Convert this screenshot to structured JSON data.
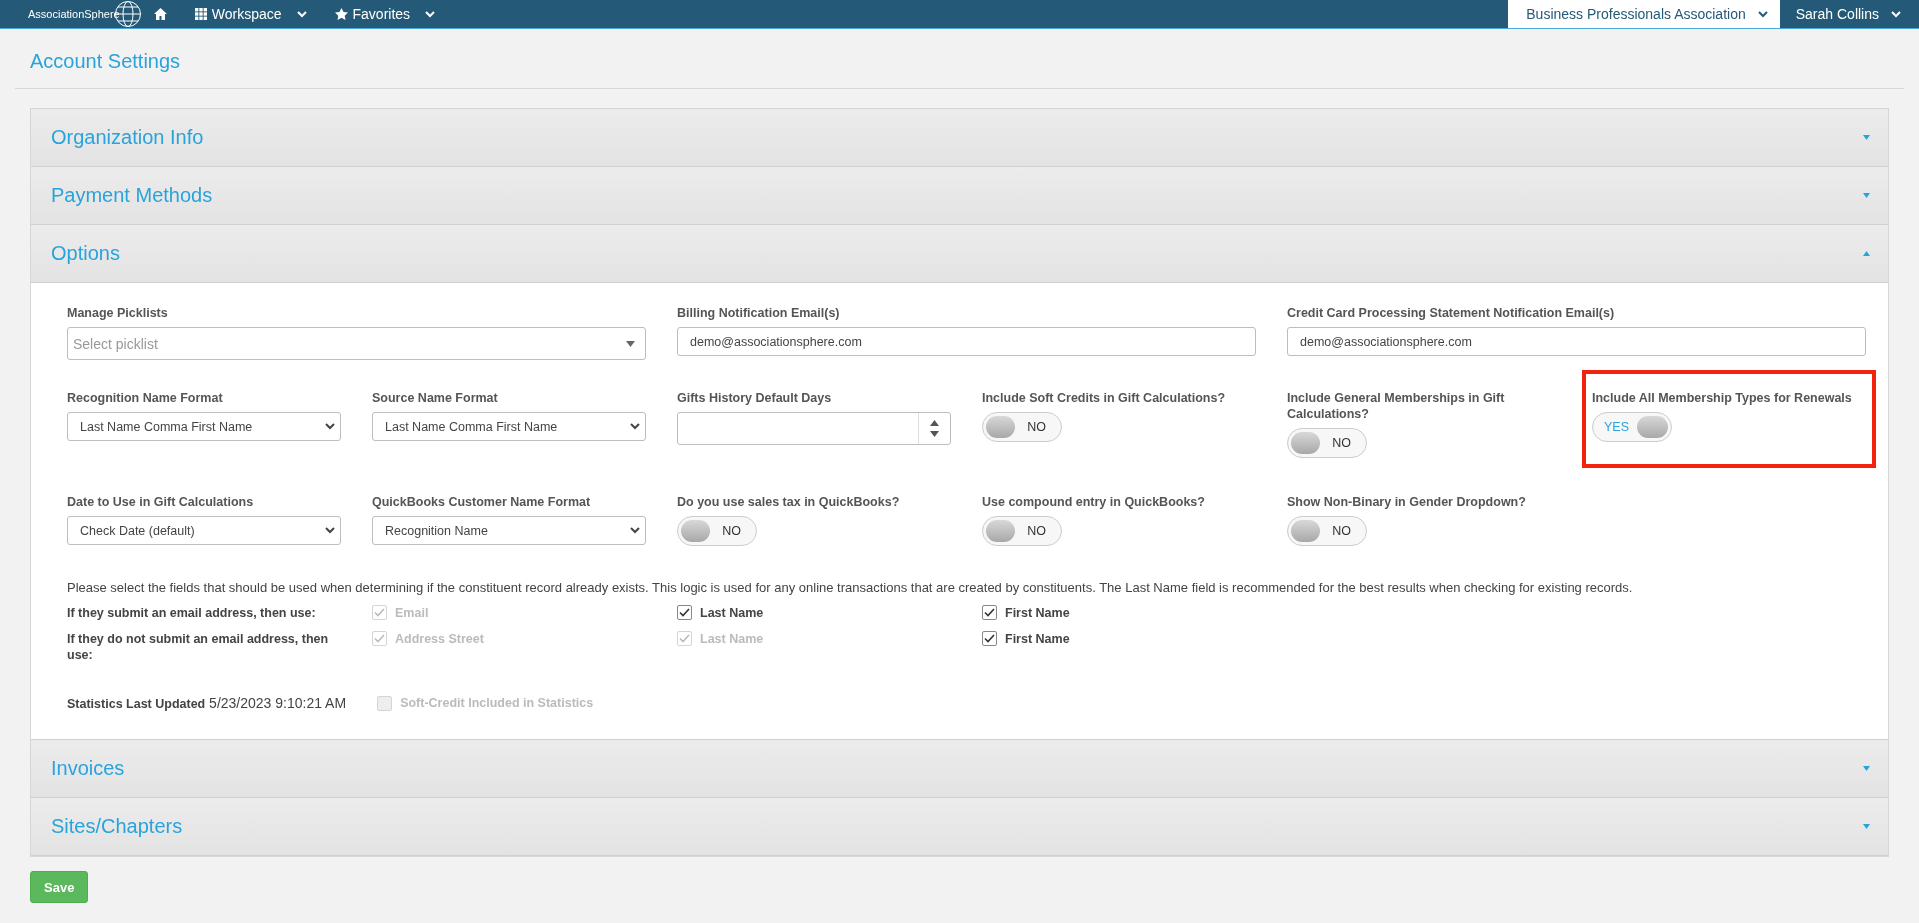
{
  "topbar": {
    "logo": "AssociationSphere",
    "nav": [
      {
        "kind": "home"
      },
      {
        "kind": "grid",
        "label": "Workspace"
      },
      {
        "kind": "star",
        "label": "Favorites"
      }
    ],
    "organization": "Business Professionals Association",
    "user": "Sarah Collins"
  },
  "page_title": "Account Settings",
  "sections": [
    {
      "title": "Organization Info",
      "expanded": false
    },
    {
      "title": "Payment Methods",
      "expanded": false
    },
    {
      "title": "Options",
      "expanded": true,
      "field_rows": [
        [
          {
            "kind": "combo",
            "label": "Manage Picklists",
            "placeholder": "Select picklist"
          },
          {
            "kind": "text",
            "label": "Billing Notification Email(s)",
            "value": "demo@associationsphere.com"
          },
          {
            "kind": "text",
            "label": "Credit Card Processing Statement Notification Email(s)",
            "value": "demo@associationsphere.com"
          }
        ],
        [
          {
            "kind": "select",
            "label": "Recognition Name Format",
            "value": "Last Name Comma First Name"
          },
          {
            "kind": "select",
            "label": "Source Name Format",
            "value": "Last Name Comma First Name"
          },
          {
            "kind": "number",
            "label": "Gifts History Default Days"
          },
          {
            "kind": "toggle",
            "label": "Include Soft Credits in Gift Calculations?",
            "on": false,
            "state_label": "NO"
          },
          {
            "kind": "toggle",
            "label": "Include General Memberships in Gift Calculations?",
            "on": false,
            "state_label": "NO"
          },
          {
            "kind": "toggle",
            "label": "Include All Membership Types for Renewals",
            "on": true,
            "state_label": "YES",
            "highlighted": true
          }
        ],
        [
          {
            "kind": "select",
            "label": "Date to Use in Gift Calculations",
            "value": "Check Date (default)"
          },
          {
            "kind": "select",
            "label": "QuickBooks Customer Name Format",
            "value": "Recognition Name"
          },
          {
            "kind": "toggle",
            "label": "Do you use sales tax in QuickBooks?",
            "on": false,
            "state_label": "NO"
          },
          {
            "kind": "toggle",
            "label": "Use compound entry in QuickBooks?",
            "on": false,
            "state_label": "NO"
          },
          {
            "kind": "toggle",
            "label": "Show Non-Binary in Gender Dropdown?",
            "on": false,
            "state_label": "NO"
          }
        ]
      ],
      "match_note": "Please select the fields that should be used when determining if the constituent record already exists. This logic is used for any online transactions that are created by constituents. The Last Name field is recommended for the best results when checking for existing records.",
      "match_rows": [
        {
          "label": "If they submit an email address, then use:",
          "options": [
            {
              "label": "Email",
              "checked": true,
              "disabled": true
            },
            {
              "label": "Last Name",
              "checked": true,
              "disabled": false
            },
            {
              "label": "First Name",
              "checked": true,
              "disabled": false
            }
          ]
        },
        {
          "label": "If they do not submit an email address, then use:",
          "options": [
            {
              "label": "Address Street",
              "checked": true,
              "disabled": true
            },
            {
              "label": "Last Name",
              "checked": true,
              "disabled": true
            },
            {
              "label": "First Name",
              "checked": true,
              "disabled": false
            }
          ]
        }
      ],
      "statistics": "**Statistics Last Updated** 5/23/2023 9:10:21 AM",
      "statistics_option": {
        "label": "Soft-Credit Included in Statistics",
        "checked": false,
        "disabled": true
      }
    },
    {
      "title": "Invoices",
      "expanded": false
    },
    {
      "title": "Sites/Chapters",
      "expanded": false
    }
  ],
  "save_button": "Save"
}
